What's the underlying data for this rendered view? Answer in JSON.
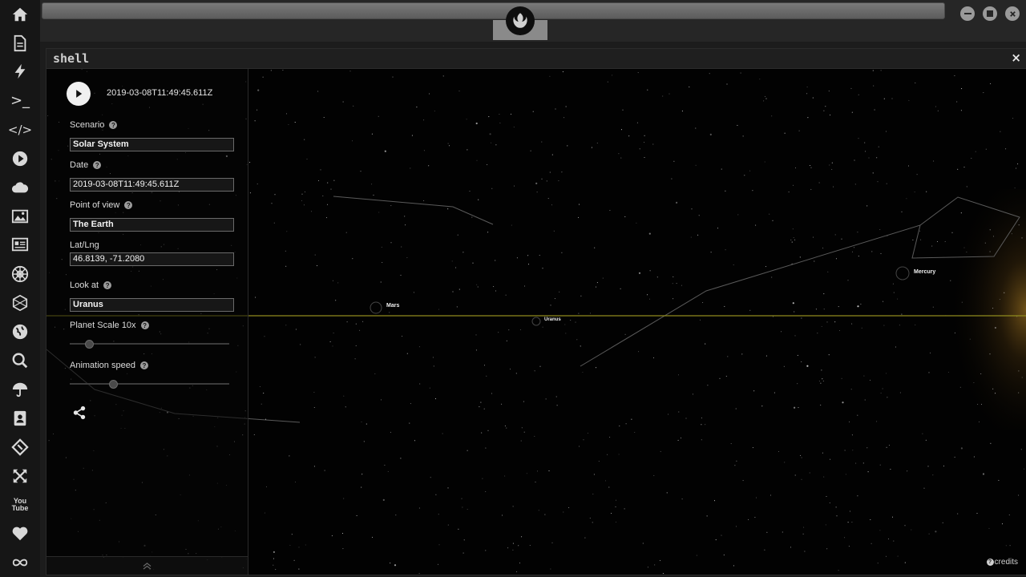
{
  "shell": {
    "title": "shell",
    "close_label": "×"
  },
  "controls": {
    "current_time": "2019-03-08T11:49:45.611Z",
    "scenario": {
      "label": "Scenario",
      "value": "Solar System"
    },
    "date": {
      "label": "Date",
      "value": "2019-03-08T11:49:45.611Z"
    },
    "point_of_view": {
      "label": "Point of view",
      "value": "The Earth"
    },
    "latlng": {
      "label": "Lat/Lng",
      "value": "46.8139, -71.2080"
    },
    "look_at": {
      "label": "Look at",
      "value": "Uranus"
    },
    "planet_scale": {
      "label": "Planet Scale 10x",
      "level": 0.12
    },
    "animation_speed": {
      "label": "Animation speed",
      "level": 0.27
    },
    "help_glyph": "?"
  },
  "planets": {
    "mars": "Mars",
    "uranus": "Uranus",
    "mercury": "Mercury"
  },
  "credits": {
    "label": "credits",
    "glyph": "?"
  },
  "dock": {
    "icons": [
      "home-icon",
      "document-icon",
      "bolt-icon",
      "terminal-icon",
      "code-icon",
      "play-icon",
      "cloud-icon",
      "image-icon",
      "news-icon",
      "rebel-icon",
      "hexagon-icon",
      "globe-icon",
      "search-icon",
      "umbrella-icon",
      "contact-icon",
      "git-icon",
      "expand-icon",
      "youtube-icon",
      "heart-icon",
      "infinity-icon"
    ],
    "terminal_glyph": ">_",
    "code_glyph": "</>",
    "youtube_text": "You\nTube"
  },
  "colors": {
    "accent_horizon": "#8f8a1e",
    "panel_bg": "#080808",
    "sun_glow": "#c8922a"
  }
}
